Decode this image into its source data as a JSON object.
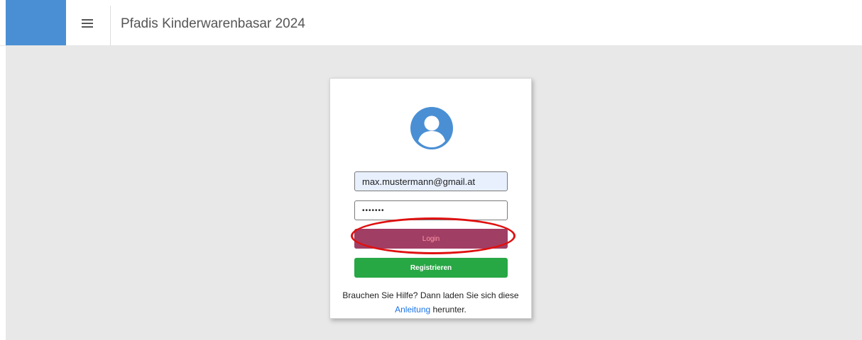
{
  "header": {
    "app_title": "Pfadis Kinderwarenbasar 2024",
    "brand_color": "#4a8fd4",
    "menu_icon": "hamburger-menu-icon"
  },
  "login": {
    "user_icon": "user-circle-icon",
    "email_value": "max.mustermann@gmail.at",
    "password_value": "•••••••",
    "login_label": "Login",
    "register_label": "Registrieren",
    "help_prefix": "Brauchen Sie Hilfe? Dann laden Sie sich diese",
    "help_link": "Anleitung",
    "help_suffix": " herunter.",
    "login_color": "#4a8fd4",
    "register_color": "#28a745",
    "link_color": "#1a73e8"
  },
  "annotation": {
    "highlight_color": "#e01010"
  }
}
